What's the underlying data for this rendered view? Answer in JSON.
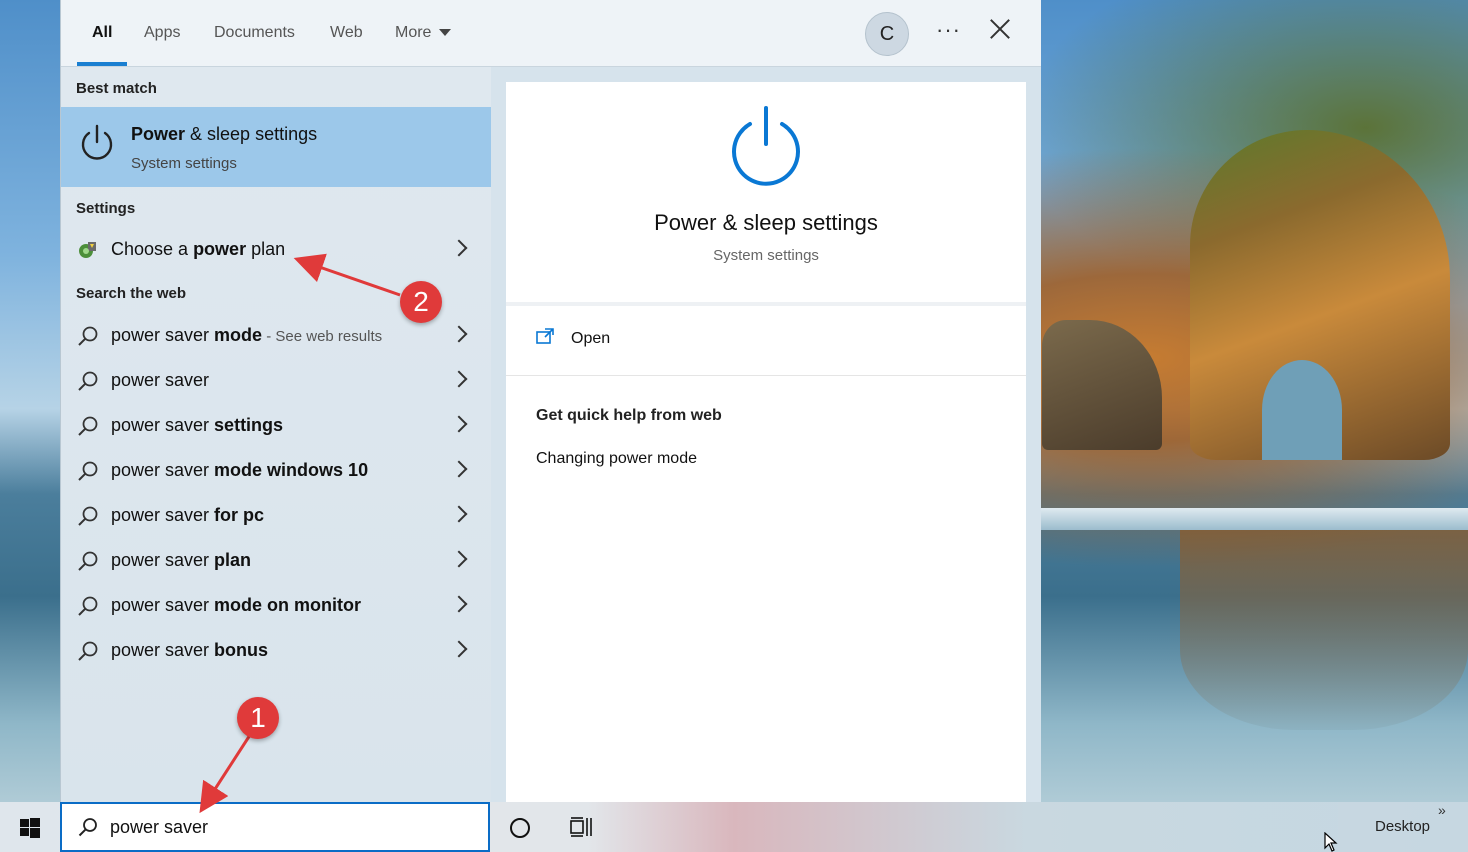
{
  "search_panel": {
    "tabs": [
      {
        "label": "All",
        "active": true
      },
      {
        "label": "Apps"
      },
      {
        "label": "Documents"
      },
      {
        "label": "Web"
      },
      {
        "label": "More"
      }
    ],
    "avatar_initial": "C",
    "more_options_label": "···"
  },
  "results": {
    "best_match_header": "Best match",
    "best_match": {
      "title_bold": "Power",
      "title_rest": " & sleep settings",
      "subtitle": "System settings",
      "icon": "power-icon"
    },
    "settings_header": "Settings",
    "settings_items": [
      {
        "pre": "Choose a ",
        "bold": "power",
        "post": " plan",
        "icon": "power-plan-icon"
      }
    ],
    "web_header": "Search the web",
    "web_items": [
      {
        "pre": "power saver ",
        "bold": "mode",
        "hint": " - See web results"
      },
      {
        "pre": "power saver",
        "bold": "",
        "hint": ""
      },
      {
        "pre": "power saver ",
        "bold": "settings",
        "hint": ""
      },
      {
        "pre": "power saver ",
        "bold": "mode windows 10",
        "hint": ""
      },
      {
        "pre": "power saver ",
        "bold": "for pc",
        "hint": ""
      },
      {
        "pre": "power saver ",
        "bold": "plan",
        "hint": ""
      },
      {
        "pre": "power saver ",
        "bold": "mode on monitor",
        "hint": ""
      },
      {
        "pre": "power saver ",
        "bold": "bonus",
        "hint": ""
      }
    ]
  },
  "detail": {
    "title": "Power & sleep settings",
    "subtitle": "System settings",
    "open_label": "Open",
    "help_header": "Get quick help from web",
    "help_link": "Changing power mode"
  },
  "taskbar": {
    "search_value": "power saver",
    "desktop_label": "Desktop",
    "overflow_label": "»"
  },
  "annotations": {
    "badge_1": "1",
    "badge_2": "2",
    "color": "#e03a3a"
  },
  "colors": {
    "accent": "#1a7fd1",
    "best_match_bg": "#9cc8ea"
  }
}
